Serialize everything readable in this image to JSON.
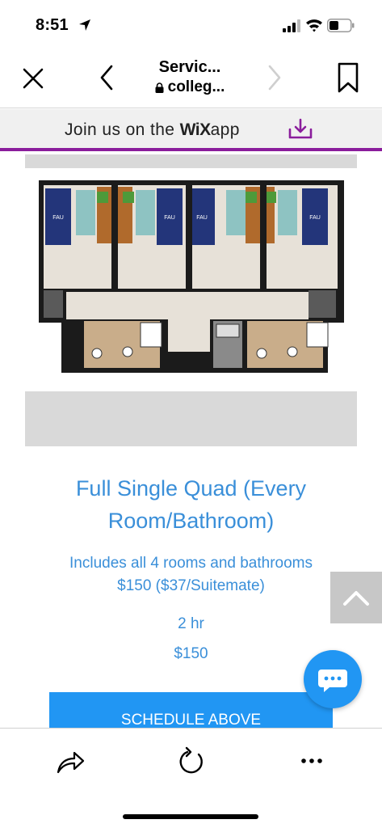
{
  "status_bar": {
    "time": "8:51"
  },
  "browser": {
    "title": "Servic...",
    "url": "colleg..."
  },
  "banner": {
    "prefix": "Join us on the ",
    "brand": "WiX",
    "suffix": "app"
  },
  "item": {
    "title": "Full Single Quad (Every Room/Bathroom)",
    "desc_line1": "Includes all 4 rooms and bathrooms",
    "desc_line2": "$150 ($37/Suitemate)",
    "duration": "2 hr",
    "price": "$150",
    "cta": "SCHEDULE ABOVE"
  },
  "floor_plan": {
    "pillow_label": "FAU"
  },
  "colors": {
    "accent": "#3a8fd9",
    "button": "#2196f3",
    "banner_line": "#8a1d9c"
  }
}
